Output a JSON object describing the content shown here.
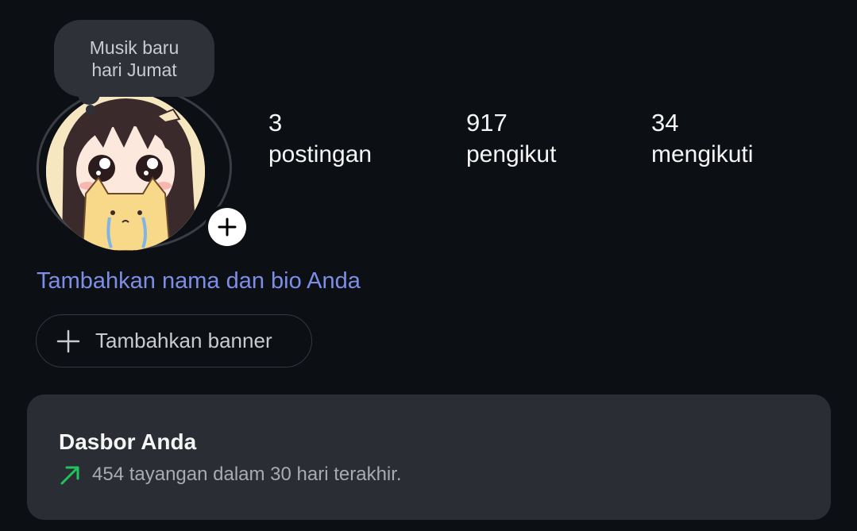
{
  "note": {
    "line1": "Musik baru",
    "line2": "hari Jumat"
  },
  "stats": [
    {
      "value": "3",
      "label": "postingan"
    },
    {
      "value": "917",
      "label": "pengikut"
    },
    {
      "value": "34",
      "label": "mengikuti"
    }
  ],
  "profile": {
    "add_bio_link": "Tambahkan nama dan bio Anda"
  },
  "banner": {
    "label": "Tambahkan banner"
  },
  "dashboard": {
    "title": "Dasbor Anda",
    "summary": "454 tayangan dalam 30 hari terakhir."
  },
  "icons": {
    "add_story": "plus-icon",
    "add_banner": "plus-icon",
    "trend": "trending-up-arrow-icon"
  },
  "colors": {
    "background": "#0c0f14",
    "link": "#7d8ee6",
    "card": "#2a2d33",
    "trend_green": "#21c35c"
  }
}
